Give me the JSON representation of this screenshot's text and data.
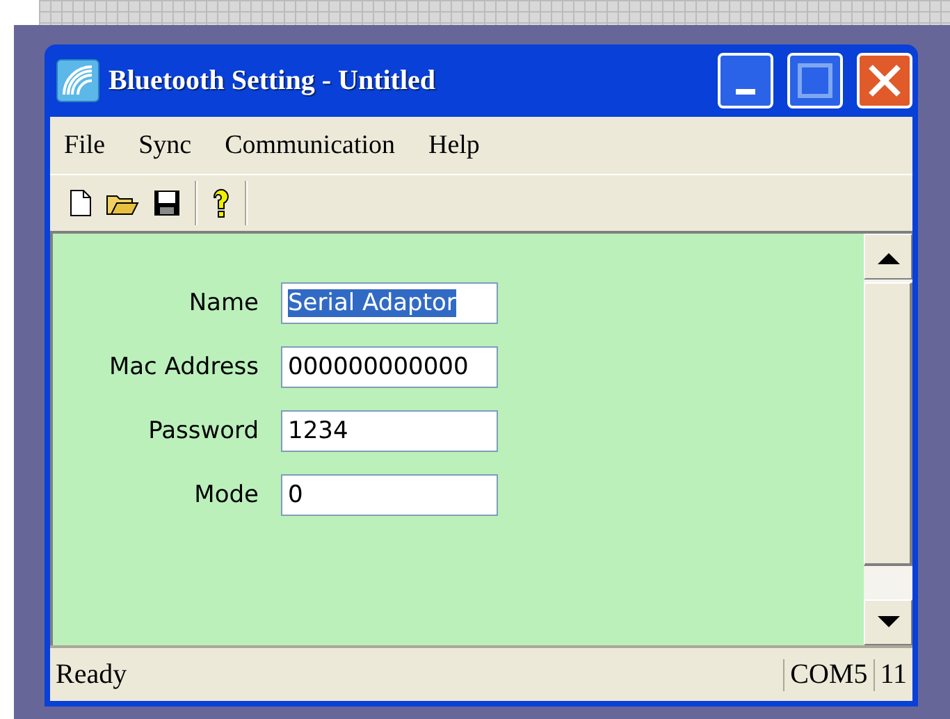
{
  "window": {
    "title": "Bluetooth Setting - Untitled"
  },
  "menu": [
    "File",
    "Sync",
    "Communication",
    "Help"
  ],
  "fields": [
    {
      "label": "Name",
      "value": "Serial Adaptor",
      "selected": true
    },
    {
      "label": "Mac Address",
      "value": "000000000000",
      "selected": false
    },
    {
      "label": "Password",
      "value": "1234",
      "selected": false
    },
    {
      "label": "Mode",
      "value": "0",
      "selected": false
    }
  ],
  "status_bar": [
    "Ready",
    "COM5",
    "11"
  ]
}
